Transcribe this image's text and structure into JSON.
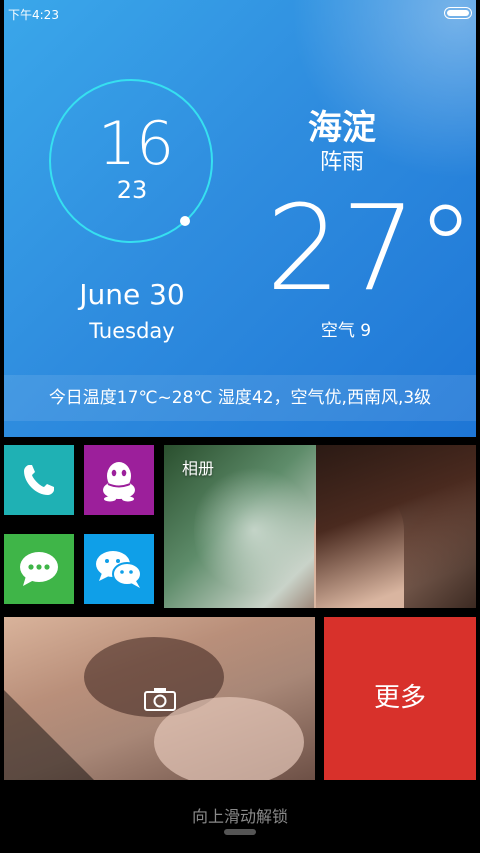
{
  "status_bar": {
    "time": "下午4:23",
    "battery_icon": "battery-full-icon"
  },
  "clock": {
    "hour": "16",
    "minute": "23",
    "ring_color": "#36e0f0"
  },
  "date": {
    "date": "June 30",
    "weekday": "Tuesday"
  },
  "weather": {
    "location": "海淀",
    "condition": "阵雨",
    "temperature": "27°",
    "air_quality": "空气 9",
    "summary": "今日温度17℃~28℃ 湿度42，空气优,西南风,3级"
  },
  "tiles": {
    "phone": {
      "icon": "phone-icon",
      "color": "#1fb1b4"
    },
    "qq": {
      "icon": "qq-penguin-icon",
      "color": "#9c1f9b"
    },
    "sms": {
      "icon": "message-bubble-icon",
      "color": "#3fb548"
    },
    "wechat": {
      "icon": "wechat-icon",
      "color": "#0f9fe8"
    },
    "album": {
      "label": "相册"
    },
    "photo": {
      "icon": "camera-icon"
    },
    "more": {
      "label": "更多",
      "color": "#d8312b"
    }
  },
  "lock": {
    "unlock_hint": "向上滑动解锁"
  }
}
